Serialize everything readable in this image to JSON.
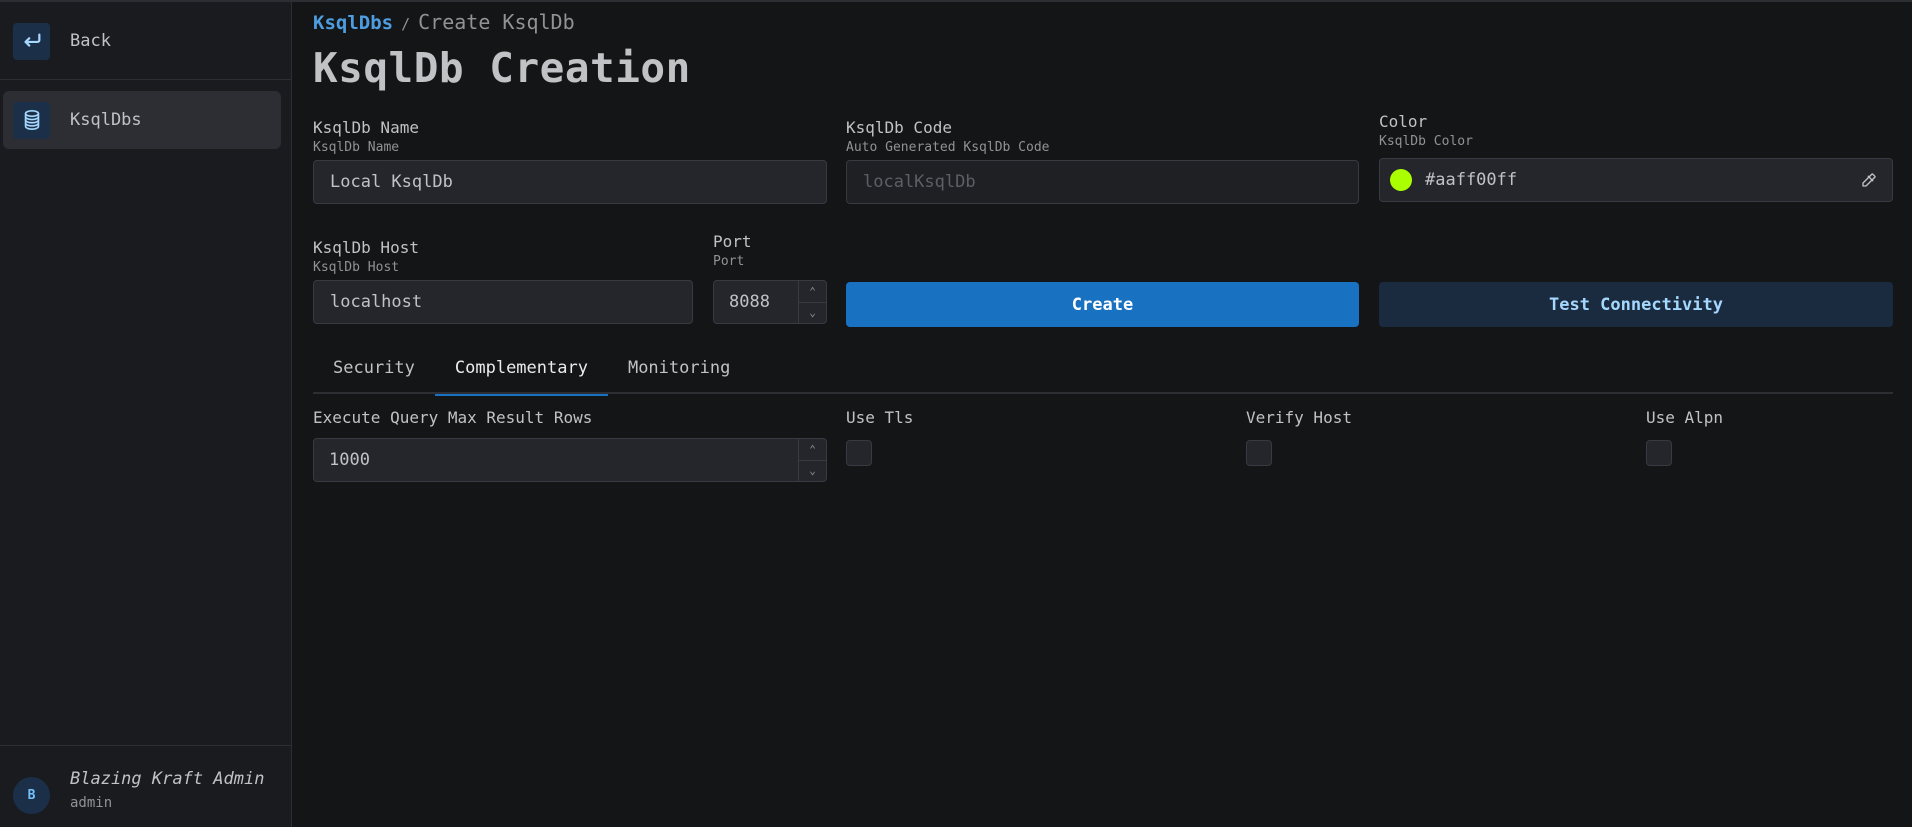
{
  "sidebar": {
    "back_label": "Back",
    "items": [
      {
        "label": "KsqlDbs",
        "icon": "database-icon",
        "active": true
      }
    ],
    "user": {
      "initial": "B",
      "name": "Blazing Kraft Admin",
      "role": "admin"
    }
  },
  "breadcrumb": {
    "parent": "KsqlDbs",
    "separator": "/",
    "current": "Create KsqlDb"
  },
  "page_title": "KsqlDb Creation",
  "form": {
    "name": {
      "label": "KsqlDb Name",
      "description": "KsqlDb Name",
      "value": "Local KsqlDb"
    },
    "code": {
      "label": "KsqlDb Code",
      "description": "Auto Generated KsqlDb Code",
      "value": "localKsqlDb",
      "disabled": true
    },
    "color": {
      "label": "Color",
      "description": "KsqlDb Color",
      "value": "#aaff00ff",
      "swatch": "#aaff00"
    },
    "host": {
      "label": "KsqlDb Host",
      "description": "KsqlDb Host",
      "value": "localhost"
    },
    "port": {
      "label": "Port",
      "description": "Port",
      "value": "8088"
    }
  },
  "buttons": {
    "create": "Create",
    "test": "Test Connectivity"
  },
  "tabs": [
    {
      "label": "Security",
      "active": false
    },
    {
      "label": "Complementary",
      "active": true
    },
    {
      "label": "Monitoring",
      "active": false
    }
  ],
  "complementary": {
    "max_rows": {
      "label": "Execute Query Max Result Rows",
      "value": "1000"
    },
    "use_tls": {
      "label": "Use Tls",
      "checked": false
    },
    "verify_host": {
      "label": "Verify Host",
      "checked": false
    },
    "use_alpn": {
      "label": "Use Alpn",
      "checked": false
    }
  },
  "colors": {
    "accent": "#1971c2",
    "link": "#4d9de0"
  }
}
